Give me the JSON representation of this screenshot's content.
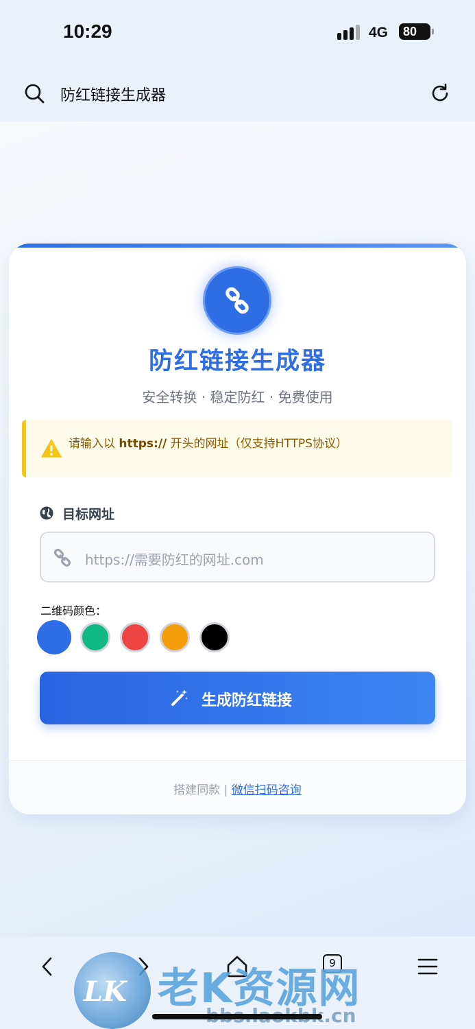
{
  "status_bar": {
    "time": "10:29",
    "network": "4G",
    "battery": "80"
  },
  "address_bar": {
    "title": "防红链接生成器"
  },
  "card": {
    "title": "防红链接生成器",
    "subtitle": "安全转换 · 稳定防红 · 免费使用",
    "notice": {
      "prefix": "请输入以 ",
      "emphasis": "https://",
      "suffix": " 开头的网址（仅支持HTTPS协议）"
    },
    "url_field": {
      "label": "目标网址",
      "placeholder": "https://需要防红的网址.com",
      "value": ""
    },
    "qr_color": {
      "label": "二维码颜色：",
      "options": [
        "#2f6de5",
        "#10b981",
        "#ef4444",
        "#f59e0b",
        "#000000"
      ],
      "selected_index": 0
    },
    "generate_button": "生成防红链接",
    "footer": {
      "text": "搭建同款 | ",
      "link": "微信扫码咨询"
    }
  },
  "bottom_bar": {
    "tab_count": "9"
  },
  "watermark": {
    "letters": "LK",
    "name": "老K资源网",
    "url": "bbs.laokbk.cn"
  },
  "colors": {
    "accent": "#2f6de5",
    "warning": "#f5c518"
  }
}
